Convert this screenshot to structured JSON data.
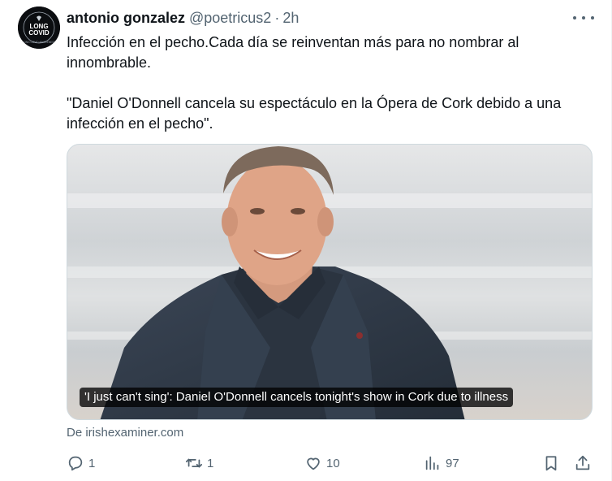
{
  "author": {
    "name": "antonio gonzalez",
    "handle": "@poetricus2",
    "separator": "·",
    "time": "2h",
    "avatar_text": [
      "LONG",
      "COVID"
    ],
    "avatar_ring_text": "LONG COVID AWARENESS"
  },
  "tweet": {
    "paragraph1": "Infección en el pecho.Cada día se reinventan más para no nombrar al innombrable.",
    "paragraph2": "\"Daniel O'Donnell cancela su espectáculo en la Ópera de Cork debido a una infección en el pecho\"."
  },
  "card": {
    "headline": "'I just can't sing': Daniel O'Donnell cancels tonight's show in Cork due to illness",
    "source": "De irishexaminer.com"
  },
  "actions": {
    "replies": "1",
    "retweets": "1",
    "likes": "10",
    "views": "97"
  },
  "icons": {
    "reply": "reply-icon",
    "retweet": "retweet-icon",
    "like": "heart-icon",
    "views": "views-icon",
    "bookmark": "bookmark-icon",
    "share": "share-icon",
    "more": "more-icon"
  },
  "colors": {
    "text": "#0f1419",
    "secondary": "#536471",
    "border": "#cfd9de"
  }
}
